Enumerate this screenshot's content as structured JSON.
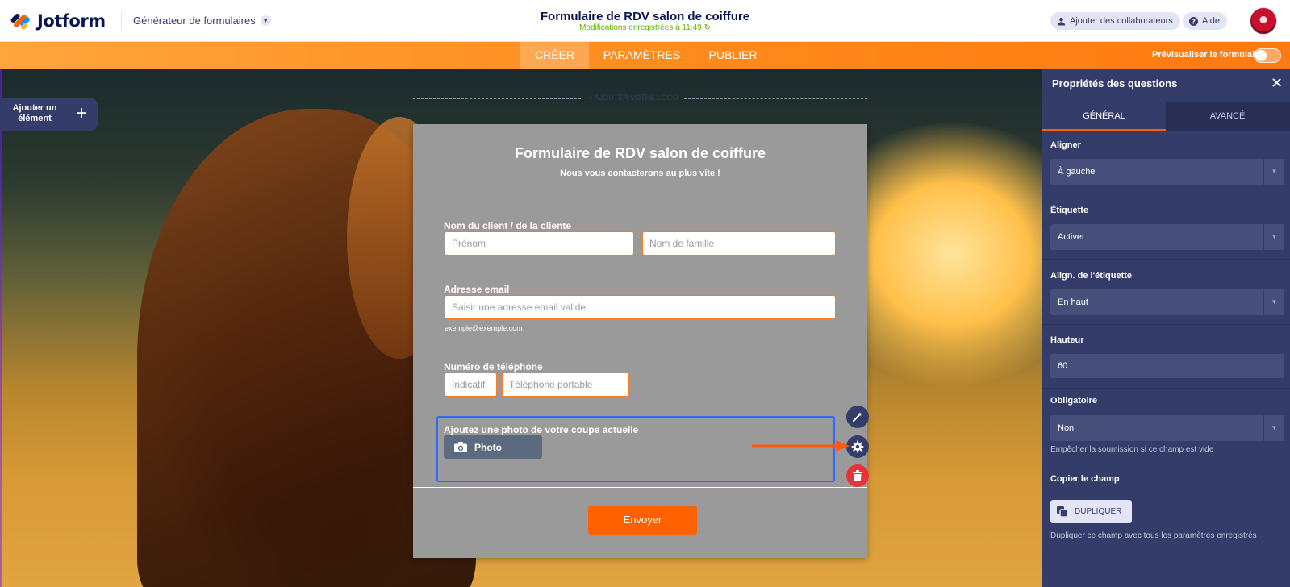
{
  "header": {
    "brand": "Jotform",
    "builder_label": "Générateur de formulaires",
    "form_title": "Formulaire de RDV salon de coiffure",
    "saved_status": "Modifications enregistrées à 11:49",
    "add_collaborators": "Ajouter des collaborateurs",
    "help": "Aide"
  },
  "nav": {
    "tabs": [
      "CRÉER",
      "PARAMÈTRES",
      "PUBLIER"
    ],
    "active_tab": "CRÉER",
    "preview_label": "Prévisualiser le formulaire",
    "preview_enabled": false
  },
  "canvas": {
    "add_element_label": "Ajouter un élément",
    "add_logo": "+ AJOUTER VOTRE LOGO"
  },
  "form": {
    "title": "Formulaire de RDV salon de coiffure",
    "subtitle": "Nous vous contacterons au plus vite !",
    "name_label": "Nom du client / de la cliente",
    "first_name_placeholder": "Prénom",
    "last_name_placeholder": "Nom de famille",
    "email_label": "Adresse email",
    "email_placeholder": "Saisir une adresse email valide",
    "email_hint": "exemple@exemple.com",
    "phone_label": "Numéro de téléphone",
    "phone_code_placeholder": "Indicatif",
    "phone_placeholder": "Téléphone portable",
    "upload_label": "Ajoutez une photo de votre coupe actuelle",
    "upload_button": "Photo",
    "submit_label": "Envoyer"
  },
  "panel": {
    "title": "Propriétés des questions",
    "tabs": [
      "GÉNÉRAL",
      "AVANCÉ"
    ],
    "align_label": "Aligner",
    "align_value": "À gauche",
    "label_label": "Étiquette",
    "label_value": "Activer",
    "label_align_label": "Align. de l'étiquette",
    "label_align_value": "En haut",
    "height_label": "Hauteur",
    "height_value": "60",
    "required_label": "Obligatoire",
    "required_value": "Non",
    "required_help": "Empêcher la soumission si ce champ est vide",
    "copy_label": "Copier le champ",
    "duplicate_button": "DUPLIQUER",
    "duplicate_help": "Dupliquer ce champ avec tous les paramètres enregistrés"
  },
  "colors": {
    "brand_navy": "#0a1551",
    "accent_orange": "#ff6100",
    "panel_bg": "#343c6a",
    "selection_blue": "#2e69ff",
    "delete_red": "#e8313a",
    "saved_green": "#64b200"
  }
}
